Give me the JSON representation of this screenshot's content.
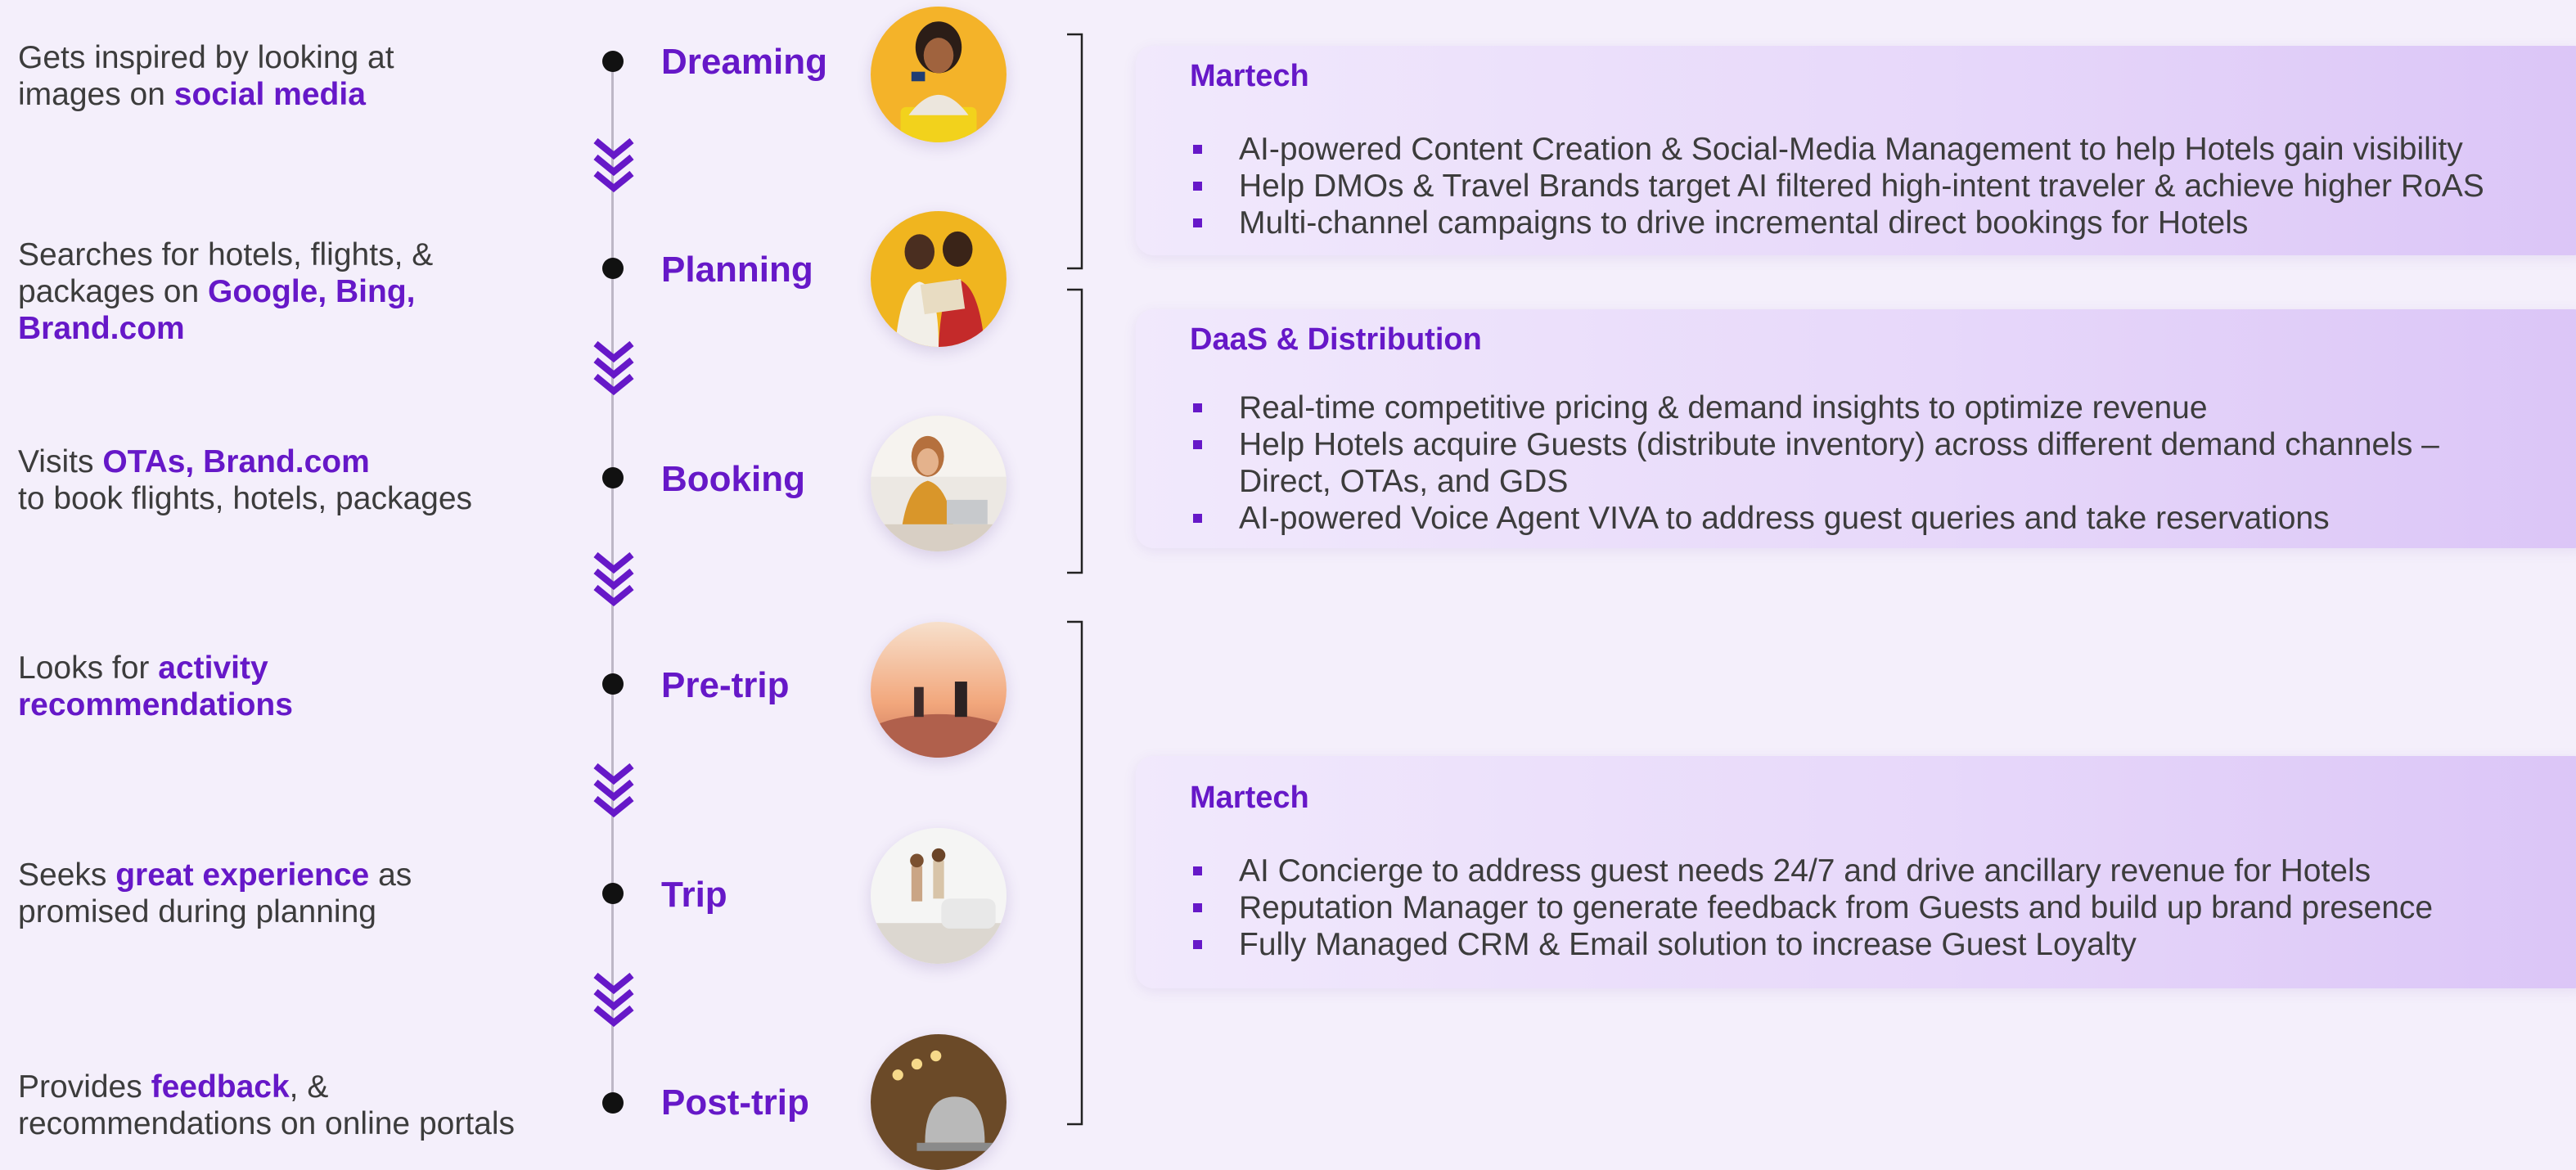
{
  "stages": [
    {
      "name": "Dreaming",
      "desc_parts": [
        "Gets inspired by looking at",
        "images on ",
        "social media"
      ],
      "photo_icon": "traveler-with-suitcase-photo"
    },
    {
      "name": "Planning",
      "desc_parts": [
        "Searches for hotels, flights, &",
        "packages on ",
        "Google, Bing, Brand.com"
      ],
      "photo_icon": "couple-with-map-photo"
    },
    {
      "name": "Booking",
      "desc_parts": [
        "Visits ",
        "OTAs, Brand.com",
        "to book flights, hotels, packages"
      ],
      "photo_icon": "woman-at-laptop-photo"
    },
    {
      "name": "Pre-trip",
      "desc_parts": [
        "Looks for ",
        "activity",
        "recommendations"
      ],
      "photo_icon": "sunset-travelers-photo"
    },
    {
      "name": "Trip",
      "desc_parts": [
        "Seeks ",
        "great experience",
        " as",
        "promised during planning"
      ],
      "photo_icon": "jumping-friends-photo"
    },
    {
      "name": "Post-trip",
      "desc_parts": [
        "Provides ",
        "feedback",
        ", &",
        "recommendations on online portals"
      ],
      "photo_icon": "service-bell-photo"
    }
  ],
  "cards": [
    {
      "title": "Martech",
      "items": [
        "AI-powered Content Creation & Social-Media Management to help Hotels gain visibility",
        "Help DMOs & Travel Brands target AI filtered high-intent traveler & achieve higher RoAS",
        "Multi-channel campaigns to drive incremental direct bookings for Hotels"
      ]
    },
    {
      "title": "DaaS & Distribution",
      "items": [
        "Real-time competitive pricing & demand insights to optimize revenue",
        "Help Hotels acquire Guests (distribute inventory) across different demand channels – Direct, OTAs, and GDS",
        "AI-powered Voice Agent VIVA to address guest queries and take reservations"
      ]
    },
    {
      "title": "Martech",
      "items": [
        "AI Concierge to address guest needs 24/7 and drive ancillary revenue for Hotels",
        "Reputation Manager to generate feedback from Guests and build up brand presence",
        "Fully Managed CRM & Email solution to increase Guest Loyalty"
      ]
    }
  ],
  "colors": {
    "accent": "#6618c8",
    "background": "#f4effb",
    "text": "#3c3c3c"
  }
}
